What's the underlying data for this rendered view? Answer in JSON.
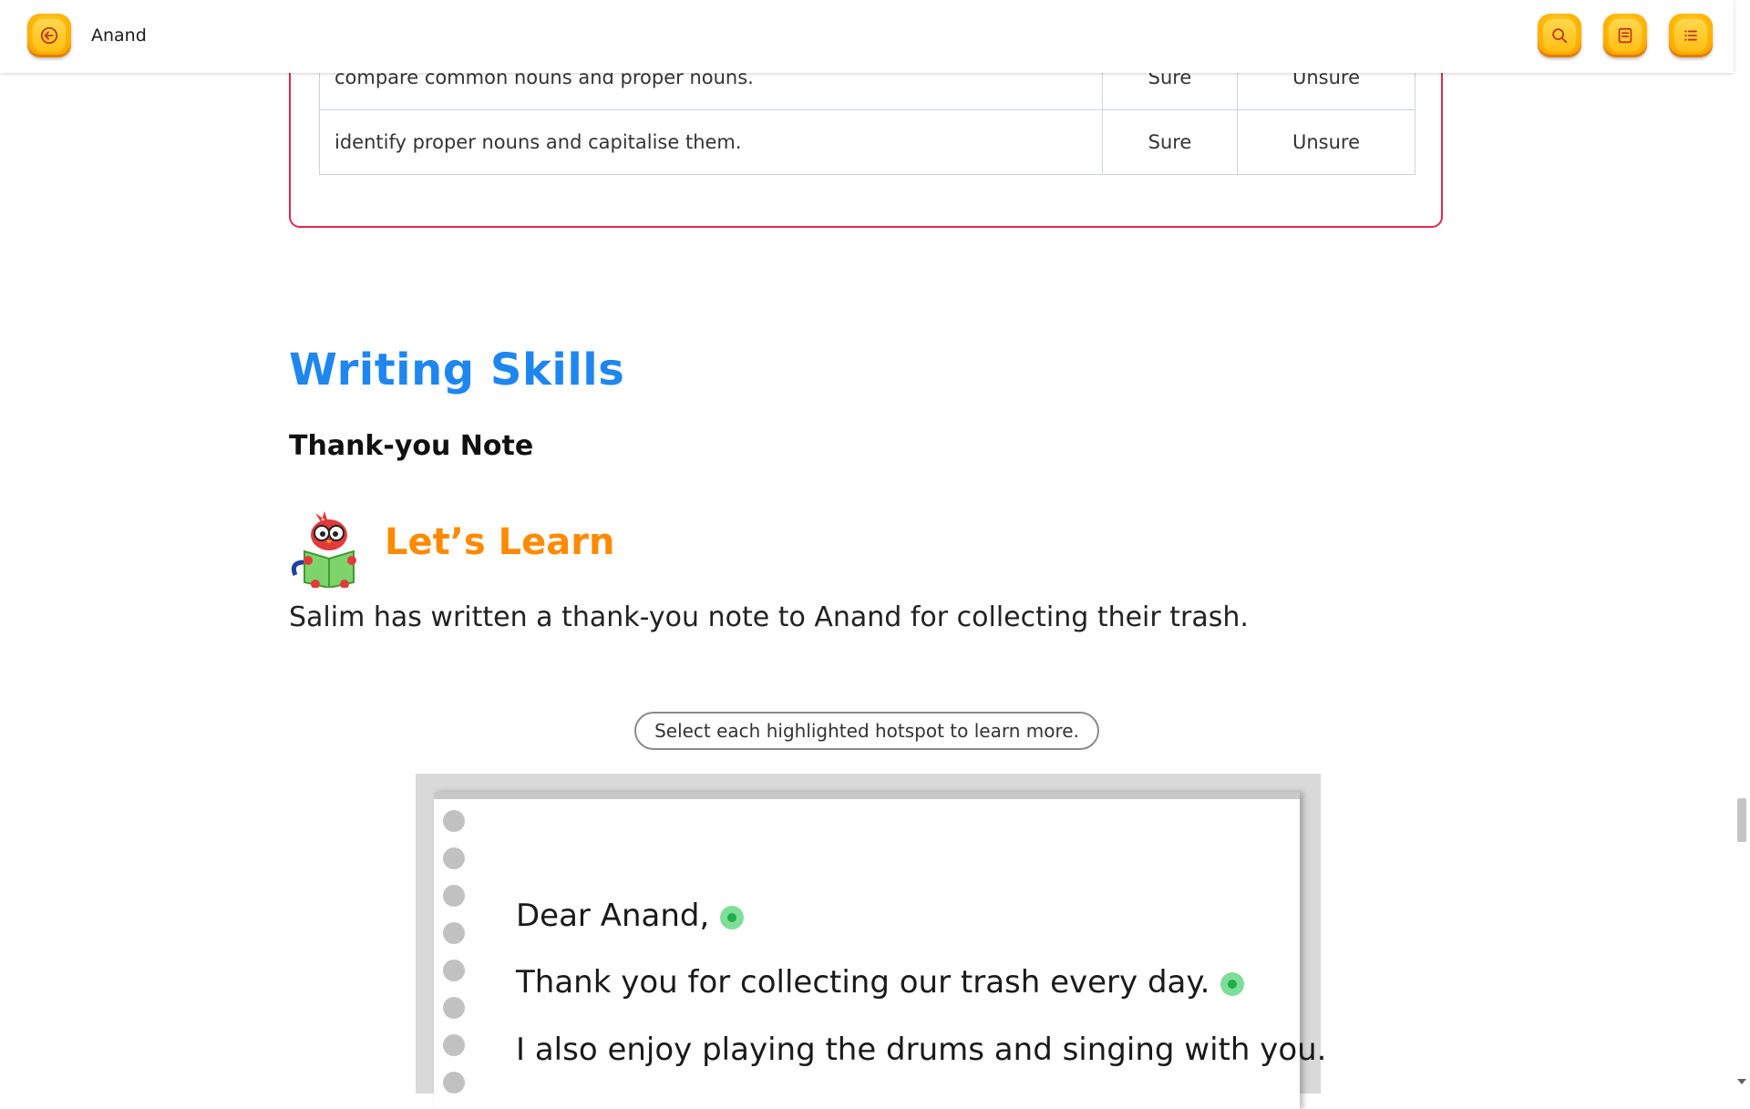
{
  "topbar": {
    "title": "Anand",
    "buttons": [
      "back",
      "search",
      "notes",
      "menu"
    ],
    "accent_color": "#ffb400"
  },
  "checklist": {
    "rows": [
      {
        "skill": "compare common nouns and proper nouns.",
        "option1": "Sure",
        "option2": "Unsure"
      },
      {
        "skill": "identify proper nouns and capitalise them.",
        "option1": "Sure",
        "option2": "Unsure"
      }
    ],
    "border_color": "#e0284f"
  },
  "section": {
    "title": "Writing Skills",
    "subheading": "Thank-you Note"
  },
  "lets_learn": {
    "title": "Let’s Learn",
    "icon": "reading-parrot-icon",
    "text": "Salim has written a thank-you note to Anand for collecting their trash."
  },
  "hotspot_hint": "Select each highlighted hotspot to learn more.",
  "note": {
    "lines": [
      "Dear Anand,",
      "Thank you for collecting our trash every day.",
      "I also enjoy playing the drums and singing with you."
    ],
    "hotspot_color": "#1fae4a"
  }
}
